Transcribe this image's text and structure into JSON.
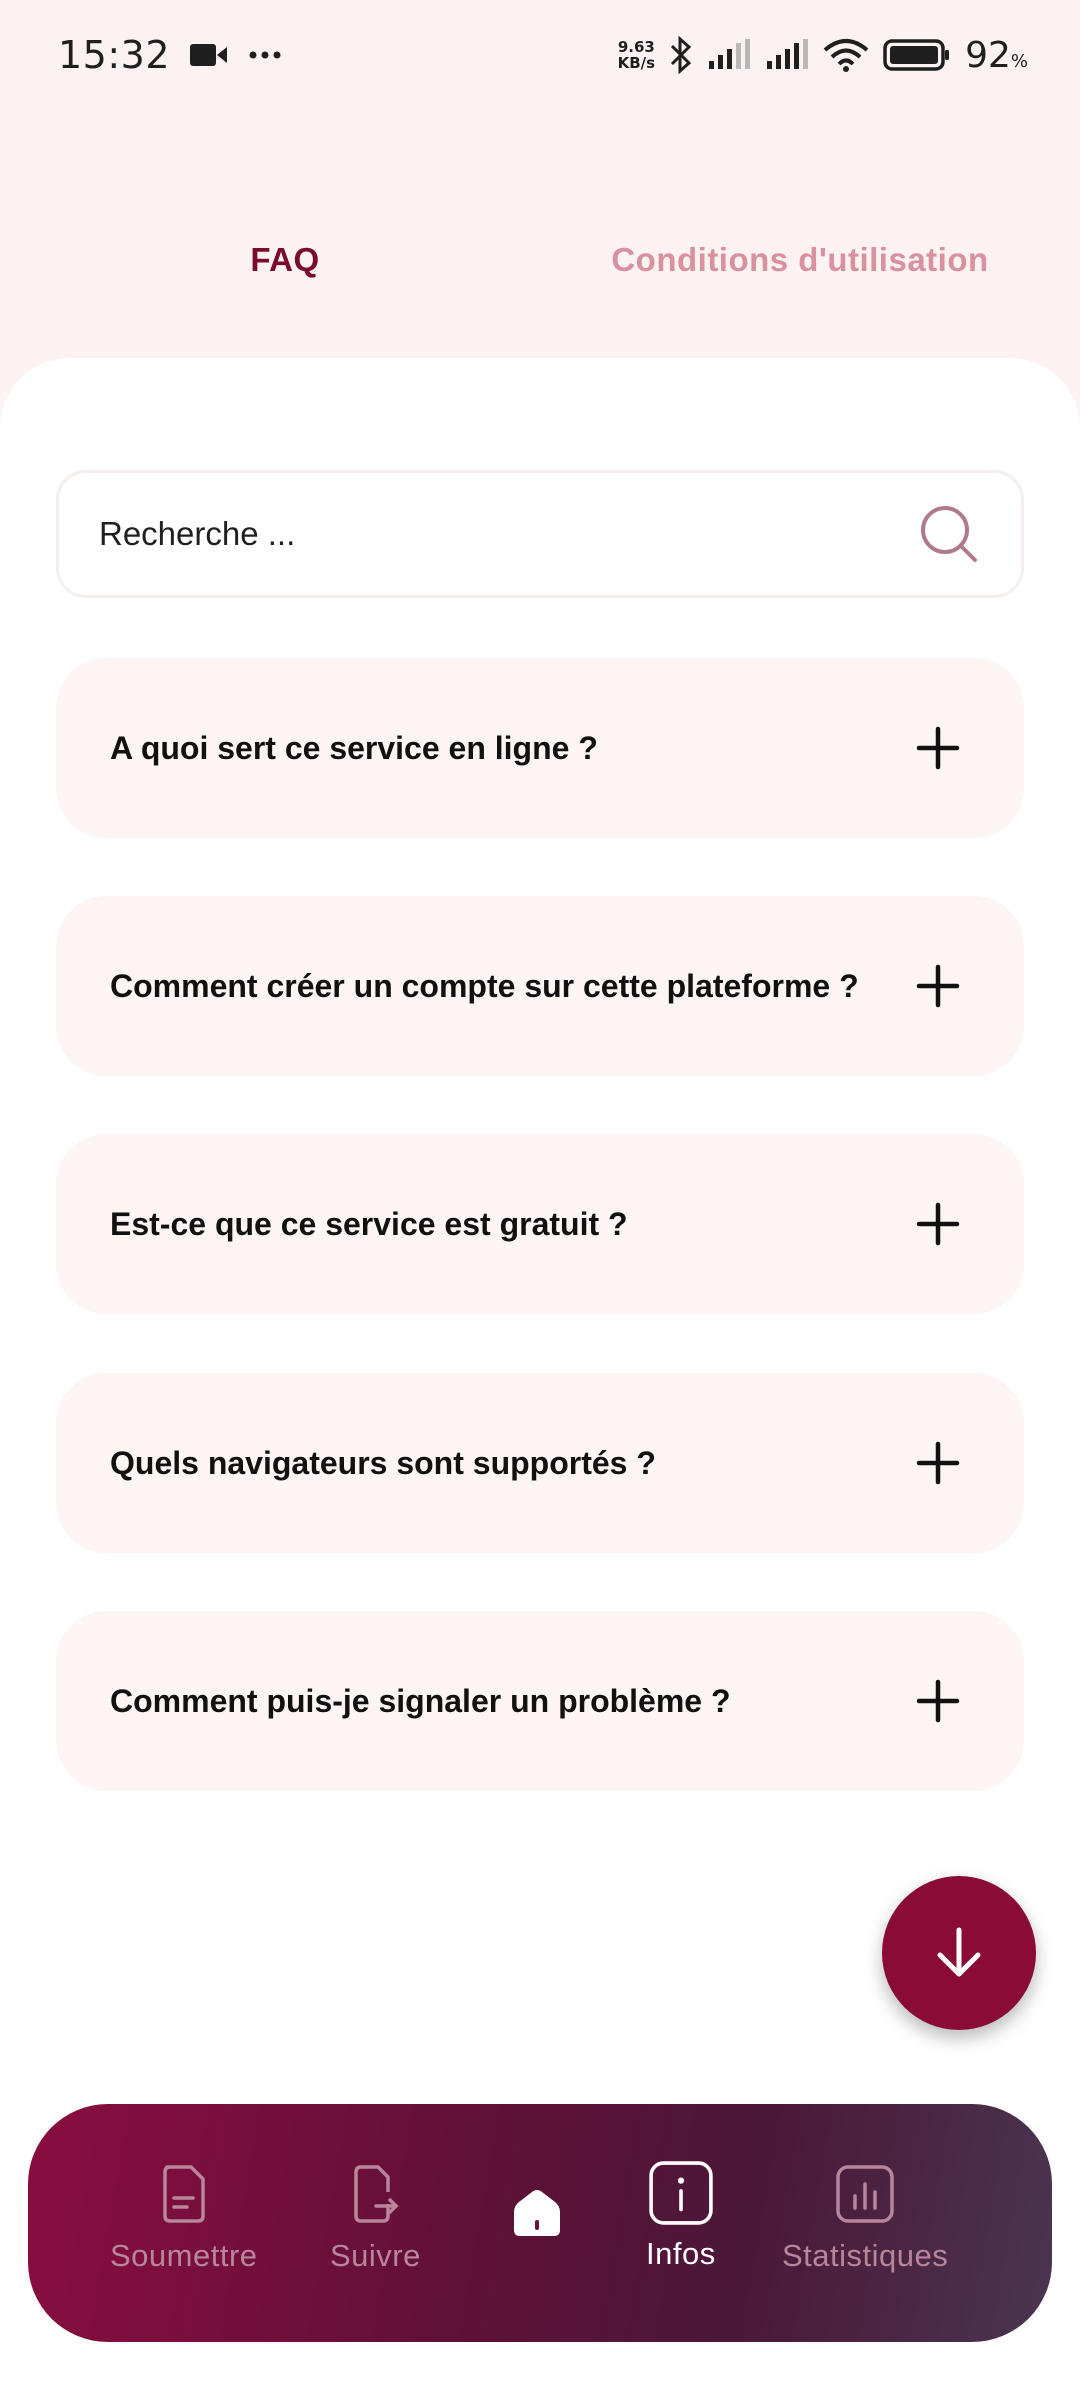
{
  "status_bar": {
    "time": "15:32",
    "net_speed_value": "9.63",
    "net_speed_unit": "KB/s",
    "battery": "92",
    "battery_unit": "%"
  },
  "tabs": [
    {
      "label": "FAQ",
      "active": true
    },
    {
      "label": "Conditions d'utilisation",
      "active": false
    }
  ],
  "search": {
    "placeholder": "Recherche ..."
  },
  "faq": [
    {
      "question": "A quoi sert ce service en ligne ?"
    },
    {
      "question": "Comment créer un compte sur cette plateforme ?"
    },
    {
      "question": "Est-ce que ce service est gratuit ?"
    },
    {
      "question": "Quels navigateurs sont supportés ?"
    },
    {
      "question": "Comment puis-je signaler un problème ?"
    }
  ],
  "bottom_nav": [
    {
      "label": "Soumettre",
      "icon": "document-icon",
      "active": false
    },
    {
      "label": "Suivre",
      "icon": "file-forward-icon",
      "active": false
    },
    {
      "label": "",
      "icon": "home-icon",
      "active": false
    },
    {
      "label": "Infos",
      "icon": "info-icon",
      "active": true
    },
    {
      "label": "Statistiques",
      "icon": "chart-icon",
      "active": false
    }
  ],
  "colors": {
    "accent": "#7a0a2e",
    "tab_inactive": "#d9909f",
    "fab": "#8a0b35",
    "card_bg": "#fcf5f4"
  }
}
